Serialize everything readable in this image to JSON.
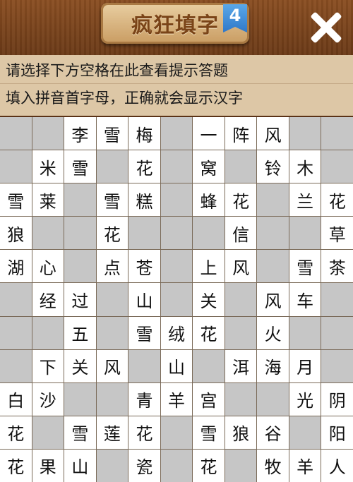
{
  "header": {
    "title": "疯狂填字",
    "level": "4",
    "close_icon": "close-x-icon"
  },
  "hints": {
    "line1": "请选择下方空格在此查看提示答题",
    "line2": "填入拼音首字母，正确就会显示汉字"
  },
  "colors": {
    "blocked": "#c6c6c6",
    "open": "#ffffff",
    "frame": "#5a3216",
    "hint_bg": "#ddc7a6",
    "badge": "#2f78c8"
  },
  "grid": [
    [
      "#",
      "#",
      "李",
      "雪",
      "梅",
      "#",
      "一",
      "阵",
      "风",
      "#",
      "#"
    ],
    [
      "#",
      "米",
      "雪",
      "#",
      "花",
      "#",
      "窝",
      "#",
      "铃",
      "木",
      "#"
    ],
    [
      "雪",
      "莱",
      "#",
      "雪",
      "糕",
      "#",
      "蜂",
      "花",
      "#",
      "兰",
      "花"
    ],
    [
      "狼",
      "#",
      "#",
      "花",
      "#",
      "#",
      "#",
      "信",
      "#",
      "#",
      "草"
    ],
    [
      "湖",
      "心",
      "#",
      "点",
      "苍",
      "#",
      "上",
      "风",
      "#",
      "雪",
      "茶"
    ],
    [
      "#",
      "经",
      "过",
      "#",
      "山",
      "#",
      "关",
      "#",
      "风",
      "车",
      "#"
    ],
    [
      "#",
      "#",
      "五",
      "#",
      "雪",
      "绒",
      "花",
      "#",
      "火",
      "#",
      "#"
    ],
    [
      "#",
      "下",
      "关",
      "风",
      "#",
      "山",
      "#",
      "洱",
      "海",
      "月",
      "#"
    ],
    [
      "白",
      "沙",
      "#",
      "#",
      "青",
      "羊",
      "宫",
      "#",
      "#",
      "光",
      "阴"
    ],
    [
      "花",
      "#",
      "雪",
      "莲",
      "花",
      "#",
      "雪",
      "狼",
      "谷",
      "#",
      "阳"
    ],
    [
      "花",
      "果",
      "山",
      "#",
      "瓷",
      "#",
      "花",
      "#",
      "牧",
      "羊",
      "人"
    ]
  ]
}
